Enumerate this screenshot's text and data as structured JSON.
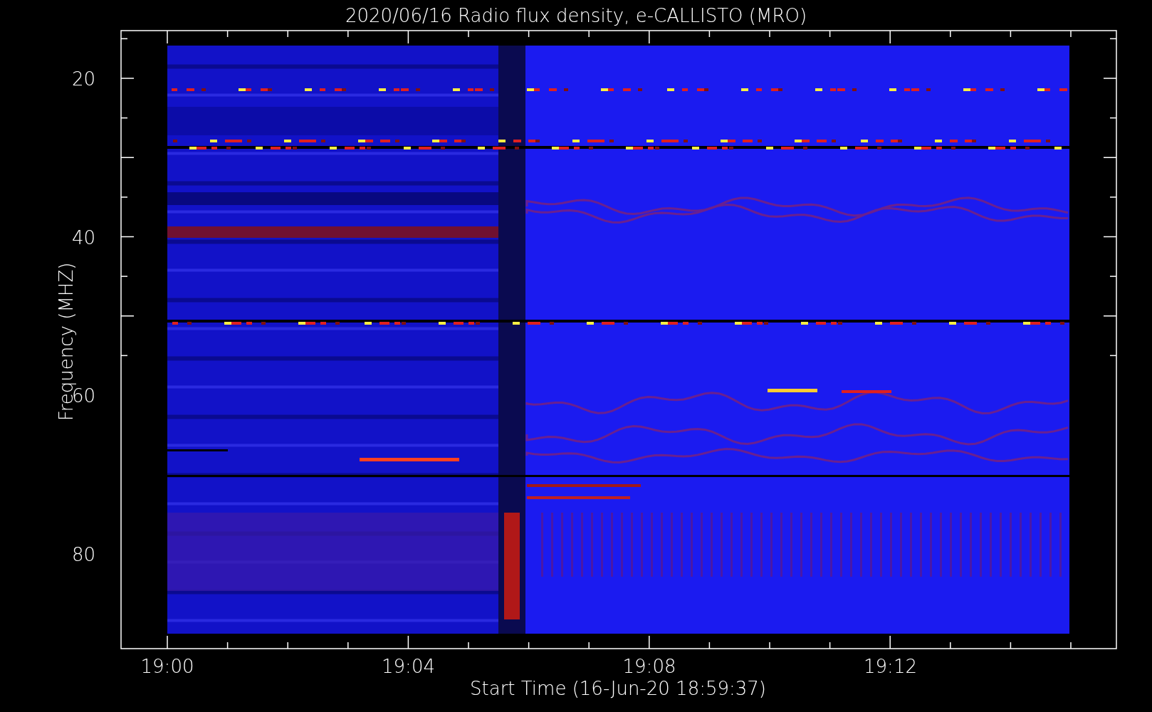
{
  "title": "2020/06/16  Radio flux density, e-CALLISTO (MRO)",
  "y_axis": {
    "label": "Frequency (MHZ)",
    "ticks": [
      "20",
      "40",
      "60",
      "80"
    ]
  },
  "x_axis": {
    "label": "Start Time (16-Jun-20 18:59:37)",
    "ticks": [
      "19:00",
      "19:04",
      "19:08",
      "19:12"
    ]
  }
}
